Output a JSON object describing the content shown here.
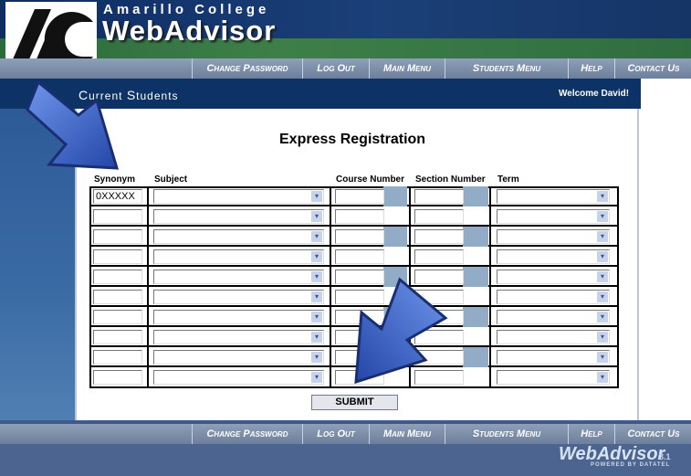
{
  "header": {
    "college_name": "Amarillo College",
    "app_name": "WebAdvisor",
    "logo_text": "AC"
  },
  "nav": {
    "items": [
      "Change Password",
      "Log Out",
      "Main Menu",
      "Students Menu",
      "Help",
      "Contact Us"
    ]
  },
  "title_bar": {
    "section_first_letter": "C",
    "section_urrent": "urrent",
    "section_second_letter": "S",
    "section_rest": "tudents",
    "welcome": "Welcome David!"
  },
  "main": {
    "page_title": "Express Registration",
    "columns": [
      "Synonym",
      "Subject",
      "Course Number",
      "Section Number",
      "Term"
    ],
    "rows": [
      {
        "synonym": "0XXXXX"
      },
      {
        "synonym": ""
      },
      {
        "synonym": ""
      },
      {
        "synonym": ""
      },
      {
        "synonym": ""
      },
      {
        "synonym": ""
      },
      {
        "synonym": ""
      },
      {
        "synonym": ""
      },
      {
        "synonym": ""
      },
      {
        "synonym": ""
      }
    ],
    "submit_label": "SUBMIT"
  },
  "footer": {
    "logo": "WebAdvisor",
    "version": "3.1",
    "powered_by": "POWERED BY DATATEL"
  },
  "colors": {
    "header_blue": "#0d2d63",
    "header_green": "#3e7f49",
    "title_bar": "#0d3266",
    "arrow": "#3a64c8"
  },
  "icons": [
    "ac-logo-icon",
    "arrow-pointer-icon",
    "dropdown-arrow-icon"
  ]
}
